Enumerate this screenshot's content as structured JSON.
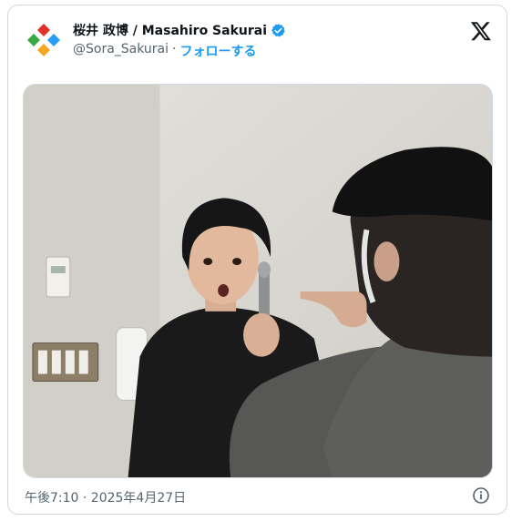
{
  "tweet": {
    "author_name": "桜井 政博 / Masahiro Sakurai",
    "handle": "@Sora_Sakurai",
    "separator": "·",
    "follow_label": "フォローする",
    "timestamp": "午後7:10 · 2025年4月27日"
  },
  "colors": {
    "accent": "#1d9bf0",
    "secondary_text": "#536471",
    "border": "#cfd9de"
  },
  "icons": {
    "avatar": "colored-diamond-logo",
    "verified": "verified-badge-icon",
    "brand": "x-logo-icon",
    "info": "info-icon"
  }
}
